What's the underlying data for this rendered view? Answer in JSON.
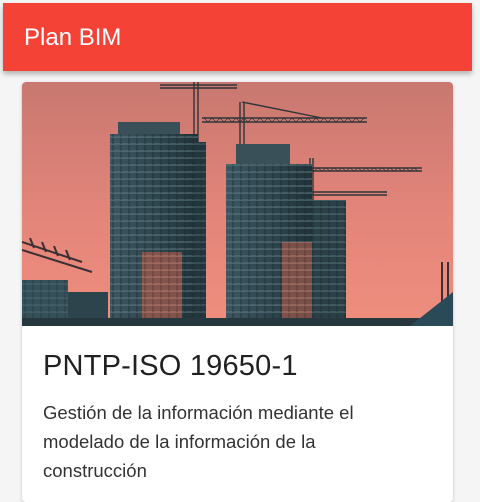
{
  "app_bar": {
    "title": "Plan BIM",
    "color": "#f44336"
  },
  "card": {
    "image": "construction-buildings-cranes-sunset",
    "title": "PNTP-ISO 19650-1",
    "description": "Gestión de la información mediante el modelado de la información de la construcción"
  }
}
